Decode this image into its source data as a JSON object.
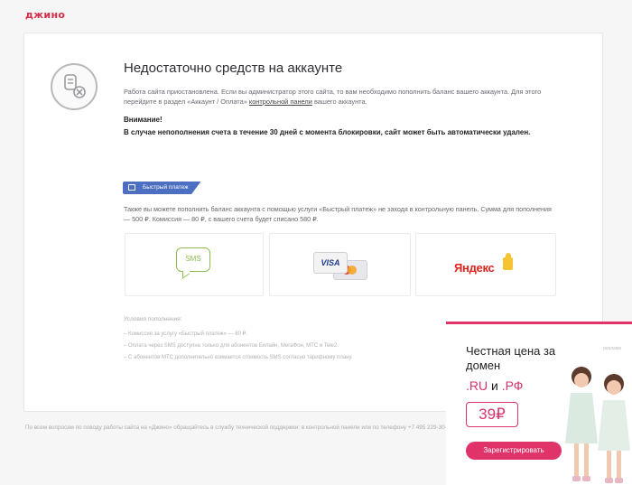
{
  "brand": {
    "logo_text": "джино",
    "accent_color": "#d32f4a"
  },
  "notice": {
    "title": "Недостаточно средств на аккаунте",
    "description_before": "Работа сайта приостановлена. Если вы администратор этого сайта, то вам необходимо пополнить баланс вашего аккаунта. Для этого перейдите в раздел «Аккаунт / Оплата»",
    "description_link": "контрольной панели",
    "description_after": "вашего аккаунта.",
    "warning_title": "Внимание!",
    "warning_text": "В случае непополнения счета в течение 30 дней с момента блокировки, сайт может быть автоматически удален."
  },
  "quick_pay": {
    "badge_label": "Быстрый платеж",
    "info": "Также вы можете пополнить баланс аккаунта с помощью услуги «Быстрый платеж» не заходя в контрольную панель. Сумма для пополнения — 500 ₽. Комиссия — 80 ₽, с вашего счета будет списано 580 ₽.",
    "methods": [
      {
        "name": "sms",
        "label": "SMS"
      },
      {
        "name": "cards",
        "label": "VISA"
      },
      {
        "name": "yandex",
        "label": "Яндекс"
      }
    ]
  },
  "conditions": {
    "title": "Условия пополнения:",
    "items": [
      "Комиссия за услугу «Быстрый платеж» — 80 ₽.",
      "Оплата через SMS доступна только для абонентов Билайн, МегаФон, МТС и Tele2.",
      "С абонентов МТС дополнительно взимается стоимость SMS согласно тарифному плану."
    ]
  },
  "footer": {
    "text": "По всем вопросам по поводу работы сайта на «Джино» обращайтесь в службу технической поддержки: в контрольной панели или по телефону +7 495 229-30-31."
  },
  "ad": {
    "label": "реклама",
    "title": "Честная цена за домен",
    "zones_part1": ".RU",
    "zones_join": "и",
    "zones_part2": ".РФ",
    "price": "39₽",
    "button": "Зарегистрировать",
    "accent_color": "#e0336a"
  }
}
